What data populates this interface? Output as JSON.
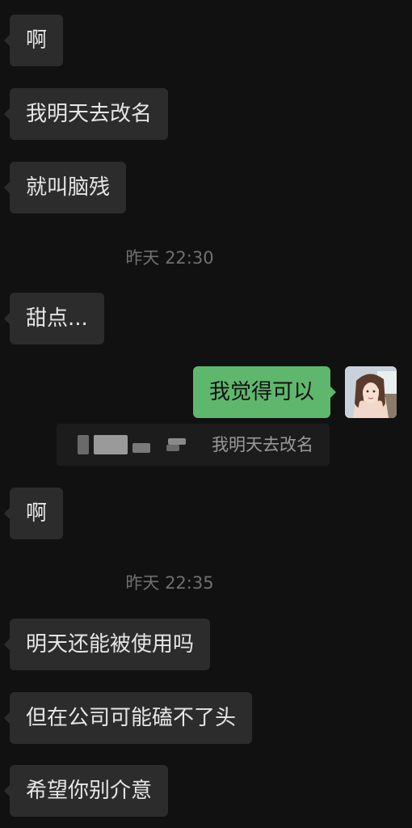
{
  "messages": [
    {
      "text": "啊"
    },
    {
      "text": "我明天去改名"
    },
    {
      "text": "就叫脑残"
    },
    {
      "text": "甜点..."
    },
    {
      "text": "我觉得可以"
    },
    {
      "text": "啊"
    },
    {
      "text": "明天还能被使用吗"
    },
    {
      "text": "但在公司可能磕不了头"
    },
    {
      "text": "希望你别介意"
    }
  ],
  "timestamps": [
    "昨天 22:30",
    "昨天 22:35"
  ],
  "quote": {
    "text": "我明天去改名"
  },
  "colors": {
    "background": "#111111",
    "incoming_bubble": "#2c2c2c",
    "outgoing_bubble": "#5fb76e",
    "timestamp": "#707070"
  }
}
